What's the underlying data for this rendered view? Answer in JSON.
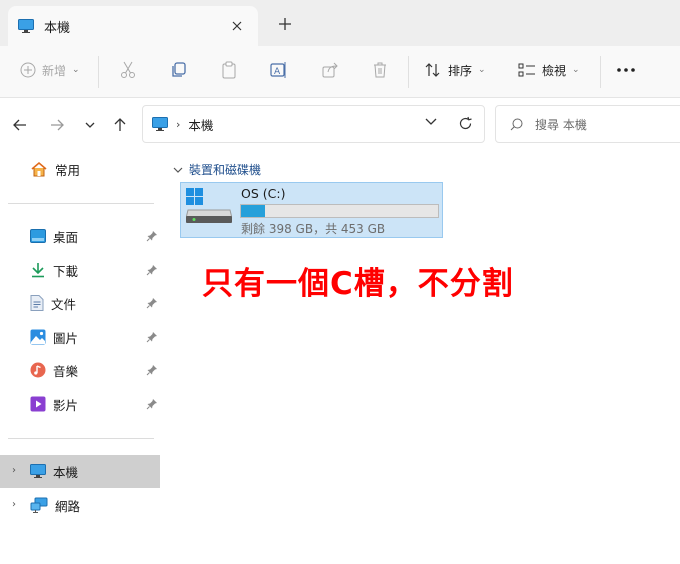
{
  "window": {
    "tab_title": "本機",
    "tab_icon": "monitor-icon",
    "close_icon": "close-icon",
    "newtab_icon": "plus-icon"
  },
  "toolbar": {
    "new_label": "新增",
    "sort_label": "排序",
    "view_label": "檢視",
    "more_icon": "more-icon"
  },
  "address": {
    "path": "本機",
    "search_placeholder": "搜尋 本機"
  },
  "sidebar": {
    "home": "常用",
    "quick": [
      {
        "label": "桌面",
        "icon": "desktop-icon"
      },
      {
        "label": "下載",
        "icon": "download-icon"
      },
      {
        "label": "文件",
        "icon": "document-icon"
      },
      {
        "label": "圖片",
        "icon": "pictures-icon"
      },
      {
        "label": "音樂",
        "icon": "music-icon"
      },
      {
        "label": "影片",
        "icon": "video-icon"
      }
    ],
    "this_pc": "本機",
    "network": "網路"
  },
  "main": {
    "group_title": "裝置和磁碟機",
    "drive": {
      "name": "OS (C:)",
      "info": "剩餘 398 GB，共 453 GB",
      "used_fraction": 0.121
    }
  },
  "annotation": "只有一個C槽，不分割",
  "colors": {
    "accent": "#26a0da",
    "selection": "#cce4f7",
    "annotation": "#ff0000"
  }
}
